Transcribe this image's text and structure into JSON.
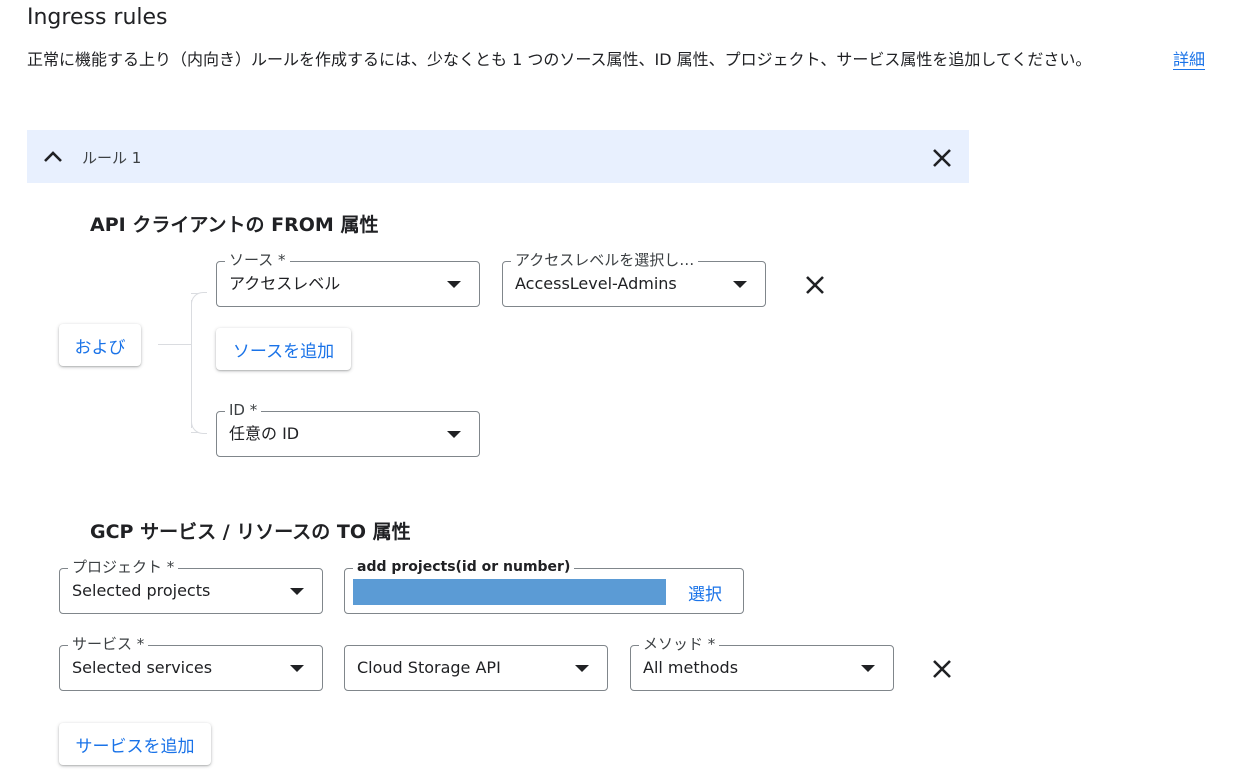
{
  "header": {
    "title": "Ingress rules",
    "description": "正常に機能する上り（内向き）ルールを作成するには、少なくとも 1 つのソース属性、ID 属性、プロジェクト、サービス属性を追加してください。",
    "learn_more": "詳細"
  },
  "rule": {
    "title": "ルール 1",
    "from_section": {
      "title": "API クライアントの FROM 属性",
      "and_button": "および",
      "source": {
        "label": "ソース *",
        "value": "アクセスレベル"
      },
      "access_level": {
        "label": "アクセスレベルを選択し…",
        "value": "AccessLevel-Admins"
      },
      "add_source_button": "ソースを追加",
      "identity": {
        "label": "ID *",
        "value": "任意の ID"
      }
    },
    "to_section": {
      "title": "GCP サービス / リソースの TO 属性",
      "project": {
        "label": "プロジェクト *",
        "value": "Selected projects"
      },
      "add_projects": {
        "label": "add projects(id or number)",
        "select_link": "選択"
      },
      "service": {
        "label": "サービス *",
        "value": "Selected services"
      },
      "service_api": {
        "value": "Cloud Storage API"
      },
      "method": {
        "label": "メソッド *",
        "value": "All methods"
      },
      "add_service_button": "サービスを追加"
    }
  },
  "colors": {
    "accent": "#1a73e8",
    "header_bg": "#e8f0fe",
    "redaction": "#5b9bd5"
  }
}
